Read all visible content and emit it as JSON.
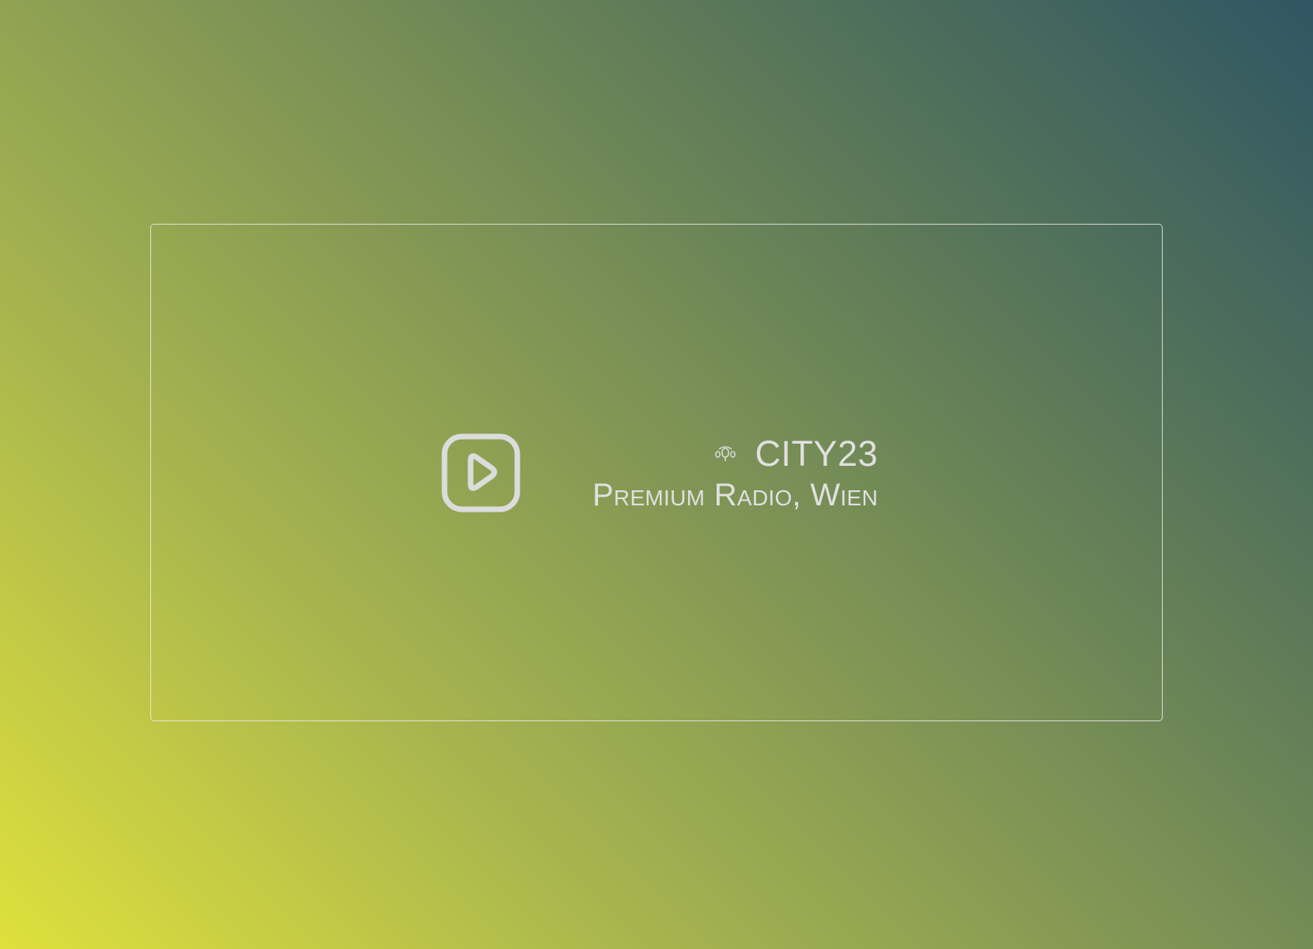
{
  "player": {
    "play_icon": "play-icon",
    "broadcast_icon": "broadcast-icon",
    "station_name": "CITY23",
    "station_subtitle": "Premium Radio, Wien"
  },
  "colors": {
    "gradient_start": "#dfe03c",
    "gradient_end": "#2f5663",
    "text": "#e0e0e0",
    "card_border": "#ebebeb"
  }
}
